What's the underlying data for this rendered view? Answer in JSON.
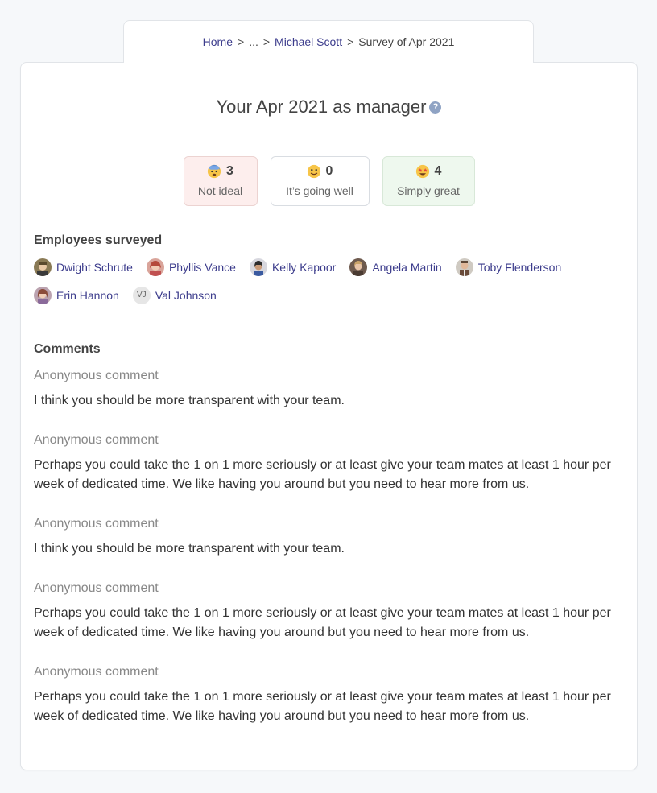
{
  "breadcrumb": {
    "home": "Home",
    "sep1": ">",
    "ellipsis": "...",
    "sep2": ">",
    "person": "Michael Scott",
    "sep3": ">",
    "current": "Survey of Apr 2021"
  },
  "title": "Your Apr 2021 as manager",
  "help_icon_glyph": "?",
  "stats": [
    {
      "emoji": "anxious-face-icon",
      "count": "3",
      "label": "Not ideal",
      "color": "#fdeeed"
    },
    {
      "emoji": "slightly-smiling-face-icon",
      "count": "0",
      "label": "It’s going well",
      "color": "#ffffff"
    },
    {
      "emoji": "star-struck-face-icon",
      "count": "4",
      "label": "Simply great",
      "color": "#eef8ee"
    }
  ],
  "employees_title": "Employees surveyed",
  "employees": [
    {
      "name": "Dwight Schrute"
    },
    {
      "name": "Phyllis Vance"
    },
    {
      "name": "Kelly Kapoor"
    },
    {
      "name": "Angela Martin"
    },
    {
      "name": "Toby Flenderson"
    },
    {
      "name": "Erin Hannon"
    },
    {
      "name": "Val Johnson",
      "initials": "VJ"
    }
  ],
  "comments_title": "Comments",
  "comments": [
    {
      "author": "Anonymous comment",
      "text": "I think you should be more transparent with your team."
    },
    {
      "author": "Anonymous comment",
      "text": "Perhaps you could take the 1 on 1 more seriously or at least give your team mates at least 1 hour per week of dedicated time. We like having you around but you need to hear more from us."
    },
    {
      "author": "Anonymous comment",
      "text": "I think you should be more transparent with your team."
    },
    {
      "author": "Anonymous comment",
      "text": "Perhaps you could take the 1 on 1 more seriously or at least give your team mates at least 1 hour per week of dedicated time. We like having you around but you need to hear more from us."
    },
    {
      "author": "Anonymous comment",
      "text": "Perhaps you could take the 1 on 1 more seriously or at least give your team mates at least 1 hour per week of dedicated time. We like having you around but you need to hear more from us."
    }
  ],
  "colors": {
    "link": "#3c3c8c",
    "background": "#f6f8fa",
    "not_ideal_bg": "#fdeeed",
    "great_bg": "#eef8ee"
  }
}
